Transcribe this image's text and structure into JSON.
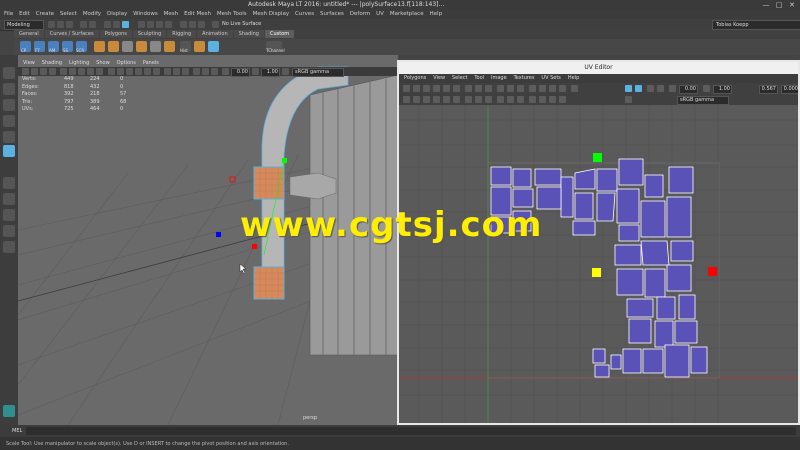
{
  "window": {
    "title": "Autodesk Maya LT 2016: untitled*    ---    |polySurface13.f[118:143]...",
    "controls": [
      "—",
      "□",
      "✕"
    ]
  },
  "menubar": [
    "File",
    "Edit",
    "Create",
    "Select",
    "Modify",
    "Display",
    "Windows",
    "Mesh",
    "Edit Mesh",
    "Mesh Tools",
    "Mesh Display",
    "Curves",
    "Surfaces",
    "Deform",
    "UV",
    "Marketplace",
    "Help"
  ],
  "statusline": {
    "mode": "Modeling",
    "no_live": "No Live Surface",
    "user": "Tobias Koepp"
  },
  "shelf": {
    "tabs": [
      "General",
      "Curves / Surfaces",
      "Polygons",
      "Sculpting",
      "Rigging",
      "Animation",
      "Shading",
      "Custom"
    ],
    "active_tab": "Custom",
    "icons": [
      {
        "label": "CP",
        "color": "#4a7fc0"
      },
      {
        "label": "FT",
        "color": "#4a7fc0"
      },
      {
        "label": "AM",
        "color": "#4a7fc0"
      },
      {
        "label": "SS",
        "color": "#4a7fc0"
      },
      {
        "label": "SCR",
        "color": "#4a7fc0"
      },
      {
        "label": "",
        "color": "#c98a3a"
      },
      {
        "label": "",
        "color": "#c98a3a"
      },
      {
        "label": "",
        "color": "#888888"
      },
      {
        "label": "",
        "color": "#c98a3a"
      },
      {
        "label": "",
        "color": "#888888"
      },
      {
        "label": "",
        "color": "#c98a3a"
      },
      {
        "label": "Hist",
        "color": "#555555"
      },
      {
        "label": "",
        "color": "#c98a3a"
      },
      {
        "label": "",
        "color": "#5bb2e0"
      },
      {
        "label": "TChannel",
        "color": "#555555"
      }
    ]
  },
  "viewport": {
    "menu": [
      "View",
      "Shading",
      "Lighting",
      "Show",
      "Options",
      "Panels"
    ],
    "toolbar_values": [
      "0.00",
      "1.00"
    ],
    "color_space": "sRGB gamma",
    "camera": "persp",
    "hud": [
      {
        "label": "Verts:",
        "a": "449",
        "b": "224",
        "c": "0"
      },
      {
        "label": "Edges:",
        "a": "818",
        "b": "432",
        "c": "0"
      },
      {
        "label": "Faces:",
        "a": "392",
        "b": "218",
        "c": "57"
      },
      {
        "label": "Tris:",
        "a": "797",
        "b": "389",
        "c": "68"
      },
      {
        "label": "UVs:",
        "a": "725",
        "b": "464",
        "c": "0"
      }
    ]
  },
  "uv_editor": {
    "title": "UV Editor",
    "menu": [
      "Polygons",
      "View",
      "Select",
      "Tool",
      "Image",
      "Textures",
      "UV Sets",
      "Help"
    ],
    "toolbar_values": [
      "0.00",
      "1.00"
    ],
    "color_space": "sRGB gamma",
    "coord_values": [
      "0.567",
      "0.000"
    ],
    "accent": "#5b52b8"
  },
  "command": {
    "label": "MEL",
    "help": "Scale Tool: Use manipulator to scale object(s). Use D or INSERT to change the pivot position and axis orientation."
  },
  "watermark": "www.cgtsj.com",
  "colors": {
    "selection": "#5bb2e0",
    "uv_shell": "#5b52b8",
    "manip_green": "#00ff00",
    "manip_yellow": "#ffff00",
    "manip_red": "#ff0000",
    "manip_blue": "#0000ff"
  }
}
